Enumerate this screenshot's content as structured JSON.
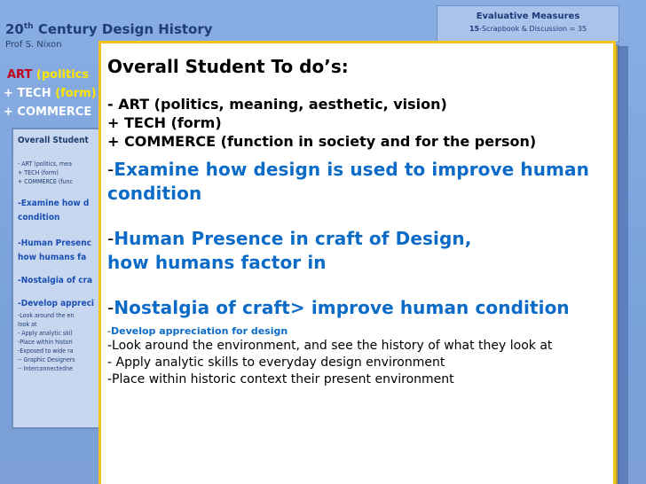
{
  "background_slide": {
    "title_prefix": "20",
    "title_sup": "th",
    "title_suffix": " Century Design History",
    "professor": "Prof S. Nixon",
    "art_word": "ART",
    "art_paren": "(politics",
    "tech_plus": "+",
    "tech_word": "TECH",
    "tech_paren": "(form)",
    "commerce_line": "+ COMMERCE"
  },
  "evaluative_measures": {
    "title": "Evaluative Measures",
    "line1_num": "15",
    "line1_text": "-Scrapbook & Discussion = 35"
  },
  "small_panel": {
    "title": "Overall Student",
    "lines": [
      "- ART (politics, mea",
      "+ TECH (form)",
      "+ COMMERCE (func"
    ],
    "blue_1a": "-Examine how d",
    "blue_1b": "condition",
    "blue_2a": "-Human Presenc",
    "blue_2b": "how humans fa",
    "blue_3": "-Nostalgia of cra",
    "blue_4": "-Develop appreci",
    "small_lines": [
      "-Look around the en",
      "look at",
      "- Apply analytic skil",
      "-Place within histori",
      "-Exposed to wide ra",
      "-- Graphic Designers",
      "-- Interconnectedne"
    ]
  },
  "main_card": {
    "title": "Overall Student To do’s:",
    "line_art": "- ART (politics, meaning, aesthetic, vision)",
    "line_tech": "+ TECH (form)",
    "line_commerce": "+ COMMERCE (function in society and for the person)",
    "bullet1_a": "Examine how design is used to improve human",
    "bullet1_b": "condition",
    "bullet2_a": "Human Presence in craft of Design,",
    "bullet2_b": "how humans factor in",
    "bullet3": "Nostalgia of craft> improve human condition",
    "bullet4": "Develop appreciation for design",
    "reg1": "-Look around the environment, and see the history of what they look at",
    "reg2": "- Apply analytic skills to everyday design environment",
    "reg3": "-Place within historic context their present environment",
    "dash": "-"
  },
  "colors": {
    "background": "#7fa6dd",
    "card_border": "#f0c31f",
    "blue_text": "#0b6bc6",
    "art_red": "#c0001a",
    "paren_yellow": "#ffe600"
  }
}
